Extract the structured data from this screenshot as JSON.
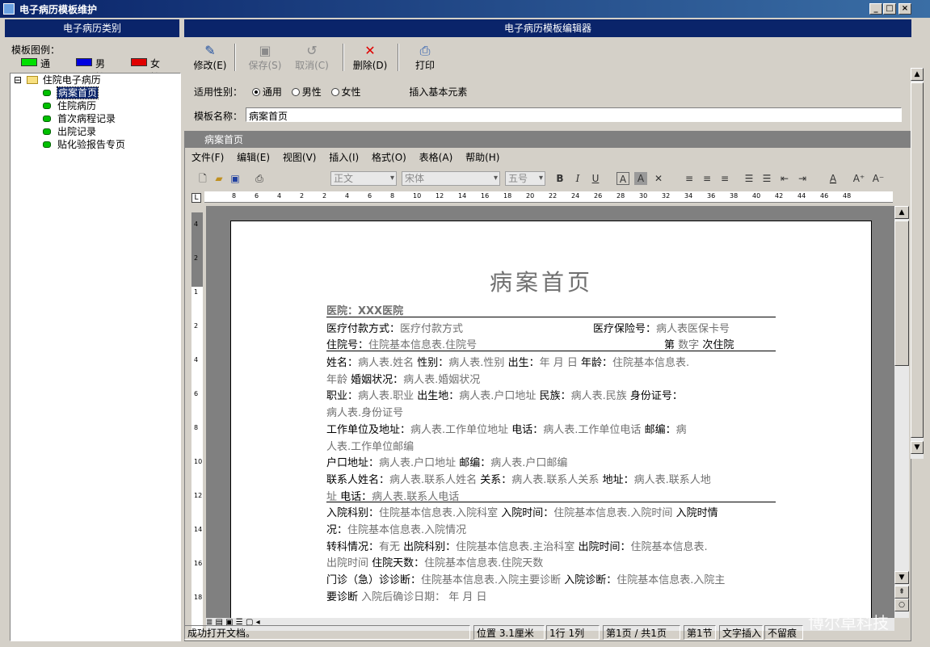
{
  "window": {
    "title": "电子病历模板维护"
  },
  "left": {
    "header": "电子病历类别",
    "legend_label": "模板图例：",
    "legend": [
      {
        "label": "通用",
        "color": "#00e000"
      },
      {
        "label": "男性",
        "color": "#0000e0"
      },
      {
        "label": "女性",
        "color": "#e00000"
      }
    ],
    "tree": {
      "toggle": "⊟",
      "root": "住院电子病历",
      "items": [
        "病案首页",
        "住院病历",
        "首次病程记录",
        "出院记录",
        "贴化验报告专页"
      ]
    }
  },
  "right": {
    "header": "电子病历模板编辑器",
    "toolbar": {
      "edit": "修改(E)",
      "save": "保存(S)",
      "cancel": "取消(C)",
      "delete": "删除(D)",
      "print": "打印"
    },
    "gender_label": "适用性别：",
    "gender_options": [
      "通用",
      "男性",
      "女性"
    ],
    "insert_label": "插入基本元素",
    "name_label": "模板名称：",
    "name_value": "病案首页"
  },
  "doc": {
    "tab_title": "病案首页",
    "menu": [
      "文件(F)",
      "编辑(E)",
      "视图(V)",
      "插入(I)",
      "格式(O)",
      "表格(A)",
      "帮助(H)"
    ],
    "style_combo": "正文",
    "font_combo": "宋体",
    "size_combo": "五号",
    "ruler_ticks": [
      "8",
      "6",
      "4",
      "2",
      "2",
      "4",
      "6",
      "8",
      "10",
      "12",
      "14",
      "16",
      "18",
      "20",
      "22",
      "24",
      "26",
      "28",
      "30",
      "32",
      "34",
      "36",
      "38",
      "40",
      "42",
      "44",
      "46",
      "48"
    ],
    "vruler_ticks": [
      "4",
      "2",
      "1",
      "2",
      "4",
      "6",
      "8",
      "10",
      "12",
      "14",
      "16",
      "18"
    ],
    "heading": "病案首页",
    "hospital": "医院：XXX医院",
    "lines": [
      {
        "l1": "医疗付款方式：",
        "f1": "医疗付款方式",
        "l2": "医疗保险号：",
        "f2": "病人表医保卡号"
      },
      {
        "l1": "住院号：",
        "f1": "住院基本信息表.住院号",
        "l2": "第",
        "f2": "数字",
        "l3": "次住院"
      }
    ],
    "body": [
      "姓名：|病人表.姓名|  性别：|病人表.性别| 出生：|年  月  日|    年龄：|住院基本信息表.",
      "|  年龄|  婚姻状况：|病人表.婚姻状况",
      "职业：|病人表.职业|     出生地：|病人表.户口地址|     民族：|病人表.民族|   身份证号：",
      "|  病人表.身份证号",
      "工作单位及地址：|病人表.工作单位地址|     电话：|病人表.工作单位电话|      邮编：|病",
      "|  人表.工作单位邮编",
      "户口地址：|病人表.户口地址| 邮编：|病人表.户口邮编",
      "联系人姓名：|病人表.联系人姓名| 关系：|病人表.联系人关系| 地址：|病人表.联系人地",
      "|  址| 电话：|病人表.联系人电话",
      "入院科别：|住院基本信息表.入院科室| 入院时间：|住院基本信息表.入院时间| 入院时情",
      "况：|住院基本信息表.入院情况",
      "转科情况：|有无|  出院科别：|住院基本信息表.主治科室| 出院时间：|住院基本信息表.",
      "|出院时间|     住院天数：|住院基本信息表.住院天数",
      "门诊（急）诊诊断：|住院基本信息表.入院主要诊断| 入院诊断：|住院基本信息表.入院主",
      "要诊断|     入院后确诊日期：  年  月  日"
    ]
  },
  "status": {
    "message": "成功打开文档。",
    "position": "位置 3.1厘米",
    "rowcol": "1行  1列",
    "pages": "第1页 / 共1页",
    "section": "第1节",
    "mode": "文字插入",
    "track": "不留痕"
  },
  "watermark": "博尔卓科技"
}
